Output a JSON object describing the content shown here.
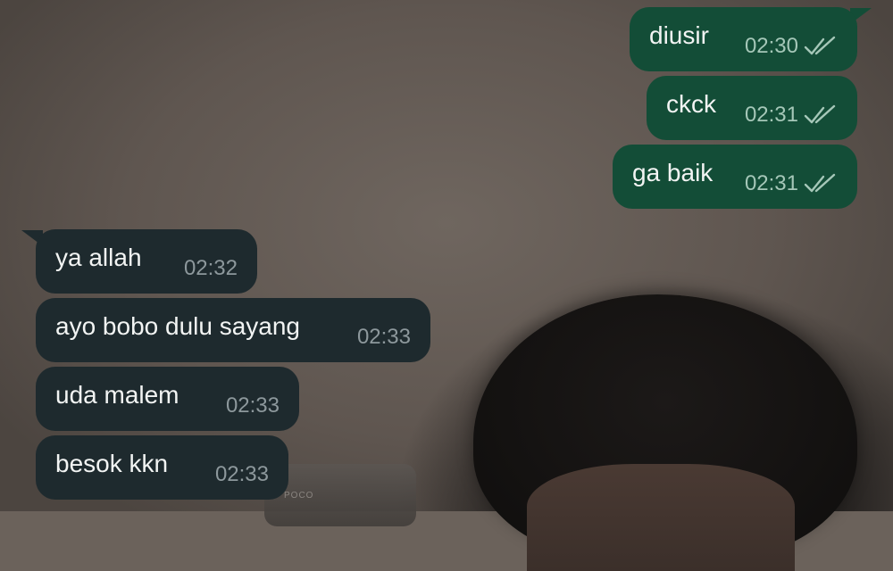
{
  "messages": {
    "outgoing": [
      {
        "text": "diusir",
        "time": "02:30",
        "status_icon": "double-check-icon"
      },
      {
        "text": "ckck",
        "time": "02:31",
        "status_icon": "double-check-icon"
      },
      {
        "text": "ga baik",
        "time": "02:31",
        "status_icon": "double-check-icon"
      }
    ],
    "incoming": [
      {
        "text": "ya allah",
        "time": "02:32"
      },
      {
        "text": "ayo bobo dulu sayang",
        "time": "02:33"
      },
      {
        "text": "uda malem",
        "time": "02:33"
      },
      {
        "text": "besok kkn",
        "time": "02:33"
      }
    ]
  },
  "wallpaper": {
    "device_label": "POCO"
  },
  "colors": {
    "outgoing_bubble": "#134d37",
    "incoming_bubble": "#1e2a2e",
    "message_text": "#f2f4f3",
    "outgoing_meta": "#a5c7b8",
    "incoming_meta": "#8d989c"
  }
}
